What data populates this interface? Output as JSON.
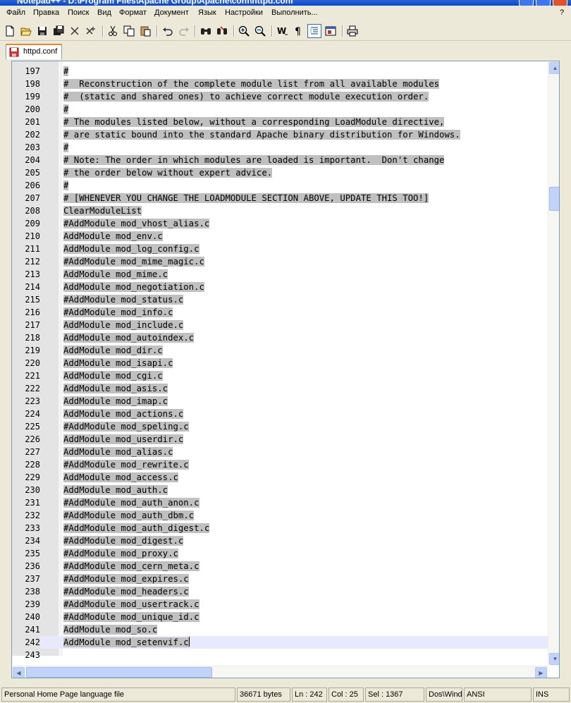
{
  "window": {
    "title": "Notepad++ - D:\\Program Files\\Apache Group\\Apache\\conf\\httpd.conf"
  },
  "menu": [
    {
      "label": "Файл"
    },
    {
      "label": "Правка"
    },
    {
      "label": "Поиск"
    },
    {
      "label": "Вид"
    },
    {
      "label": "Формат"
    },
    {
      "label": "Документ"
    },
    {
      "label": "Язык"
    },
    {
      "label": "Настройки"
    },
    {
      "label": "Выполнить..."
    },
    {
      "label": "?"
    }
  ],
  "toolbar": {
    "icons": [
      "new-file-icon",
      "open-file-icon",
      "save-icon",
      "save-all-icon",
      "close-icon",
      "close-all-icon",
      "cut-icon",
      "copy-icon",
      "paste-icon",
      "undo-icon",
      "redo-icon",
      "find-icon",
      "replace-icon",
      "zoom-in-icon",
      "zoom-out-icon",
      "word-wrap-icon",
      "show-all-chars-icon",
      "indent-guide-icon",
      "user-lang-icon",
      "print-icon"
    ]
  },
  "tab": {
    "label": "httpd.conf"
  },
  "editor": {
    "lines": [
      {
        "n": "197",
        "t": "#"
      },
      {
        "n": "198",
        "t": "#  Reconstruction of the complete module list from all available modules"
      },
      {
        "n": "199",
        "t": "#  (static and shared ones) to achieve correct module execution order."
      },
      {
        "n": "200",
        "t": "#"
      },
      {
        "n": "201",
        "t": "# The modules listed below, without a corresponding LoadModule directive,"
      },
      {
        "n": "202",
        "t": "# are static bound into the standard Apache binary distribution for Windows."
      },
      {
        "n": "203",
        "t": "#"
      },
      {
        "n": "204",
        "t": "# Note: The order in which modules are loaded is important.  Don't change"
      },
      {
        "n": "205",
        "t": "# the order below without expert advice."
      },
      {
        "n": "206",
        "t": "#"
      },
      {
        "n": "207",
        "t": "# [WHENEVER YOU CHANGE THE LOADMODULE SECTION ABOVE, UPDATE THIS TOO!]"
      },
      {
        "n": "208",
        "t": "ClearModuleList"
      },
      {
        "n": "209",
        "t": "#AddModule mod_vhost_alias.c"
      },
      {
        "n": "210",
        "t": "AddModule mod_env.c"
      },
      {
        "n": "211",
        "t": "AddModule mod_log_config.c"
      },
      {
        "n": "212",
        "t": "#AddModule mod_mime_magic.c"
      },
      {
        "n": "213",
        "t": "AddModule mod_mime.c"
      },
      {
        "n": "214",
        "t": "AddModule mod_negotiation.c"
      },
      {
        "n": "215",
        "t": "#AddModule mod_status.c"
      },
      {
        "n": "216",
        "t": "#AddModule mod_info.c"
      },
      {
        "n": "217",
        "t": "AddModule mod_include.c"
      },
      {
        "n": "218",
        "t": "AddModule mod_autoindex.c"
      },
      {
        "n": "219",
        "t": "AddModule mod_dir.c"
      },
      {
        "n": "220",
        "t": "AddModule mod_isapi.c"
      },
      {
        "n": "221",
        "t": "AddModule mod_cgi.c"
      },
      {
        "n": "222",
        "t": "AddModule mod_asis.c"
      },
      {
        "n": "223",
        "t": "AddModule mod_imap.c"
      },
      {
        "n": "224",
        "t": "AddModule mod_actions.c"
      },
      {
        "n": "225",
        "t": "#AddModule mod_speling.c"
      },
      {
        "n": "226",
        "t": "AddModule mod_userdir.c"
      },
      {
        "n": "227",
        "t": "AddModule mod_alias.c"
      },
      {
        "n": "228",
        "t": "#AddModule mod_rewrite.c"
      },
      {
        "n": "229",
        "t": "AddModule mod_access.c"
      },
      {
        "n": "230",
        "t": "AddModule mod_auth.c"
      },
      {
        "n": "231",
        "t": "#AddModule mod_auth_anon.c"
      },
      {
        "n": "232",
        "t": "#AddModule mod_auth_dbm.c"
      },
      {
        "n": "233",
        "t": "#AddModule mod_auth_digest.c"
      },
      {
        "n": "234",
        "t": "#AddModule mod_digest.c"
      },
      {
        "n": "235",
        "t": "#AddModule mod_proxy.c"
      },
      {
        "n": "236",
        "t": "#AddModule mod_cern_meta.c"
      },
      {
        "n": "237",
        "t": "#AddModule mod_expires.c"
      },
      {
        "n": "238",
        "t": "#AddModule mod_headers.c"
      },
      {
        "n": "239",
        "t": "#AddModule mod_usertrack.c"
      },
      {
        "n": "240",
        "t": "#AddModule mod_unique_id.c"
      },
      {
        "n": "241",
        "t": "AddModule mod_so.c"
      },
      {
        "n": "242",
        "t": "AddModule mod_setenvif.c"
      },
      {
        "n": "243",
        "t": ""
      }
    ]
  },
  "status": {
    "language": "Personal Home Page language file",
    "size": "36671 bytes",
    "line": "Ln : 242",
    "col": "Col : 25",
    "sel": "Sel : 1367",
    "eol": "Dos\\Windows",
    "encoding": "ANSI",
    "mode": "INS"
  }
}
